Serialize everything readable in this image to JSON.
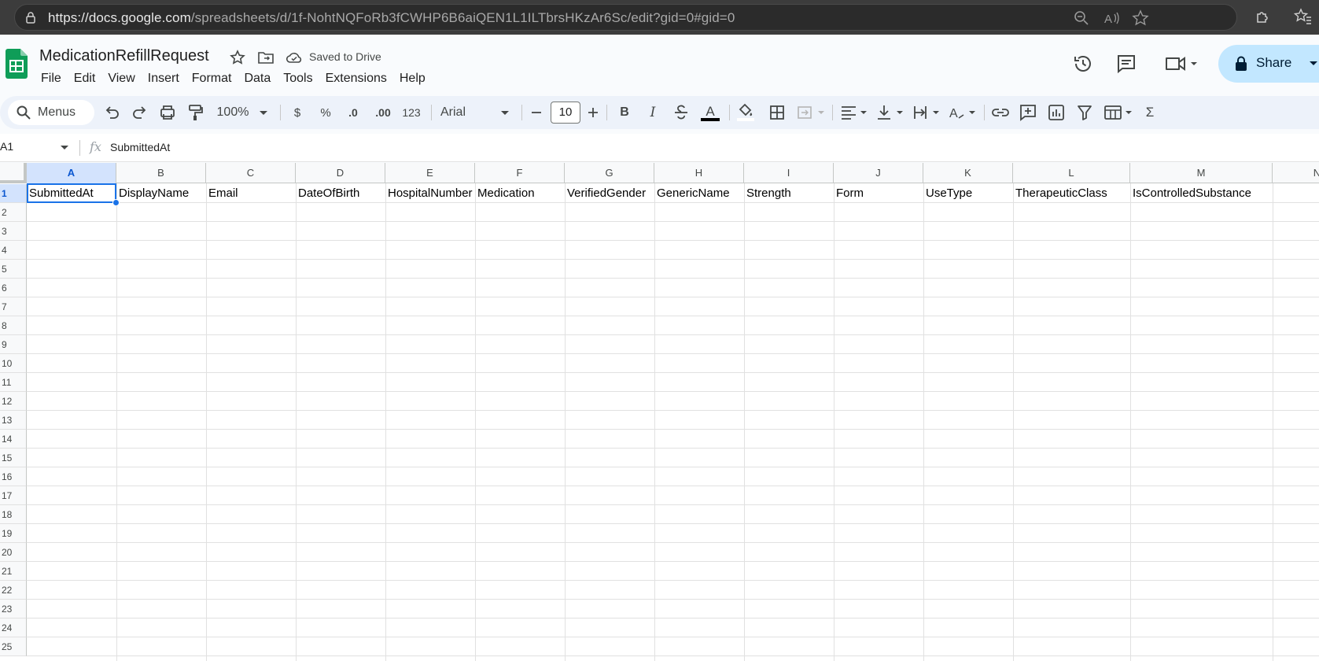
{
  "browser": {
    "url_host": "https://docs.google.com",
    "url_path": "/spreadsheets/d/1f-NohtNQFoRb3fCWHP6B6aiQEN1L1ILTbrsHKzAr6Sc/edit?gid=0#gid=0"
  },
  "doc": {
    "title": "MedicationRefillRequest",
    "saved_status": "Saved to Drive",
    "share_label": "Share"
  },
  "menu": [
    "File",
    "Edit",
    "View",
    "Insert",
    "Format",
    "Data",
    "Tools",
    "Extensions",
    "Help"
  ],
  "toolbar": {
    "search_label": "Menus",
    "zoom": "100%",
    "currency": "$",
    "percent": "%",
    "decrease_decimal": ".0",
    "increase_decimal": ".00",
    "number_format": "123",
    "font": "Arial",
    "font_size": "10",
    "bold": "B",
    "italic": "I",
    "text_color_glyph": "A",
    "sum_glyph": "Σ"
  },
  "formula_bar": {
    "cell_ref": "A1",
    "fx": "fx",
    "content": "SubmittedAt"
  },
  "grid": {
    "columns": [
      "A",
      "B",
      "C",
      "D",
      "E",
      "F",
      "G",
      "H",
      "I",
      "J",
      "K",
      "L",
      "M",
      "N"
    ],
    "rows": [
      "1",
      "2",
      "3",
      "4",
      "5",
      "6",
      "7",
      "8",
      "9",
      "10",
      "11",
      "12",
      "13",
      "14",
      "15",
      "16",
      "17",
      "18",
      "19",
      "20",
      "21",
      "22",
      "23",
      "24",
      "25"
    ],
    "row1": [
      "SubmittedAt",
      "DisplayName",
      "Email",
      "DateOfBirth",
      "HospitalNumber",
      "Medication",
      "VerifiedGender",
      "GenericName",
      "Strength",
      "Form",
      "UseType",
      "TherapeuticClass",
      "IsControlledSubstance"
    ],
    "selected_cell": "A1"
  },
  "colors": {
    "accent": "#1a73e8",
    "share_bg": "#c2e7ff",
    "sheets_green": "#0f9d58"
  }
}
